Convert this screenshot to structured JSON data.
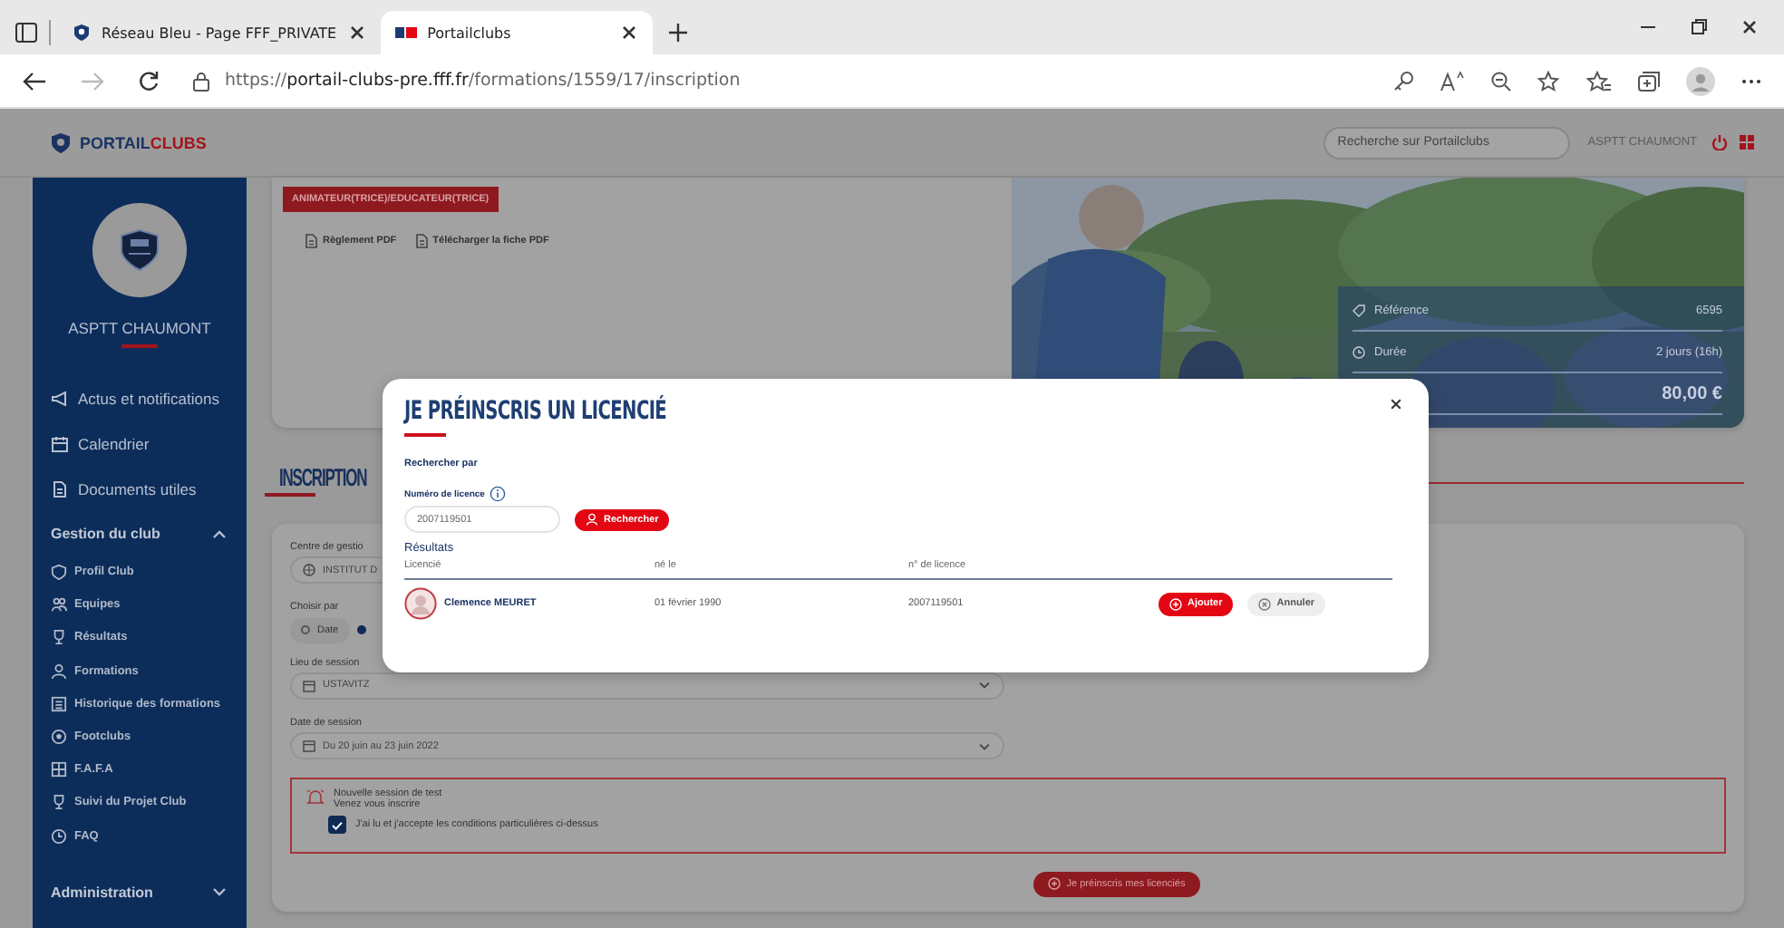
{
  "browser": {
    "tabs": [
      {
        "title": "Réseau Bleu - Page FFF_PRIVATE",
        "selected": false
      },
      {
        "title": "Portailclubs",
        "selected": true
      }
    ],
    "url": {
      "scheme": "https://",
      "host": "portail-clubs-pre.fff.fr",
      "path": "/formations/1559/17/inscription"
    }
  },
  "header": {
    "logo": [
      "PORTAIL",
      "CLUBS"
    ],
    "search_placeholder": "Recherche sur Portailclubs",
    "user": "ASPTT CHAUMONT"
  },
  "sidebar": {
    "club": "ASPTT CHAUMONT",
    "items": [
      {
        "label": "Actus et notifications"
      },
      {
        "label": "Calendrier"
      },
      {
        "label": "Documents utiles"
      }
    ],
    "sections": [
      {
        "label": "Gestion du club",
        "expanded": true,
        "children": [
          {
            "label": "Profil Club"
          },
          {
            "label": "Equipes"
          },
          {
            "label": "Résultats"
          },
          {
            "label": "Formations"
          },
          {
            "label": "Historique des formations"
          },
          {
            "label": "Footclubs"
          },
          {
            "label": "F.A.F.A"
          },
          {
            "label": "Suivi du Projet Club"
          },
          {
            "label": "FAQ"
          }
        ]
      },
      {
        "label": "Administration",
        "expanded": false
      }
    ]
  },
  "course": {
    "tag": "ANIMATEUR(TRICE)/EDUCATEUR(TRICE)",
    "links": [
      "Règlement PDF",
      "Télécharger la fiche PDF"
    ],
    "details": [
      {
        "label": "Référence",
        "value": "6595"
      },
      {
        "label": "Durée",
        "value": "2 jours (16h)"
      }
    ],
    "price": "80,00 €"
  },
  "inscription": {
    "title": "INSCRIPTION",
    "fields": [
      {
        "kind": "select",
        "label": "Centre de gestio",
        "value": "INSTITUT D"
      },
      {
        "kind": "radio",
        "label": "Choisir par",
        "options": [
          {
            "label": "Date",
            "selected": false
          },
          {
            "selected": true
          }
        ]
      },
      {
        "kind": "select",
        "label": "Lieu de session",
        "value": "USTAVITZ"
      },
      {
        "kind": "select",
        "label": "Date de session",
        "value": "Du 20 juin au 23 juin 2022"
      }
    ],
    "notice": {
      "title": "Nouvelle session de test",
      "subtitle": "Venez vous inscrire"
    },
    "agreement": {
      "label": "J'ai lu et j'accepte les conditions particulières ci-dessus",
      "checked": true
    },
    "submit": "Je préinscris mes licenciés"
  },
  "modal": {
    "title": "JE PRÉINSCRIS UN LICENCIÉ",
    "search_by": "Rechercher par",
    "field_label": "Numéro de licence",
    "field_value": "2007119501",
    "search_button": "Rechercher",
    "results_title": "Résultats",
    "columns": [
      "Licencié",
      "né le",
      "n° de licence"
    ],
    "rows": [
      {
        "name": "Clemence MEURET",
        "birth_date": "01 février 1990",
        "licence": "2007119501"
      }
    ],
    "actions": [
      {
        "label": "Ajouter",
        "kind": "primary"
      },
      {
        "label": "Annuler",
        "kind": "secondary"
      }
    ]
  }
}
